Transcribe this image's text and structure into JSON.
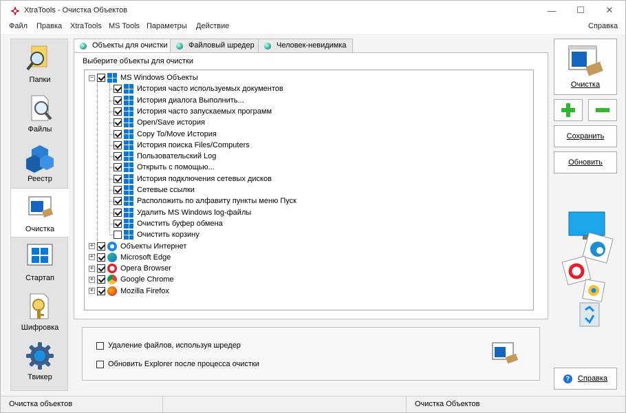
{
  "window": {
    "title": "XtraTools - Очистка Объектов"
  },
  "menu": {
    "items": [
      "Файл",
      "Правка",
      "XtraTools",
      "MS Tools",
      "Параметры",
      "Действие"
    ],
    "help": "Справка"
  },
  "sidebar": {
    "items": [
      {
        "label": "Папки",
        "icon": "folder-search-icon"
      },
      {
        "label": "Файлы",
        "icon": "file-search-icon"
      },
      {
        "label": "Реестр",
        "icon": "registry-icon"
      },
      {
        "label": "Очистка",
        "icon": "cleanup-icon",
        "active": true
      },
      {
        "label": "Стартап",
        "icon": "startup-icon"
      },
      {
        "label": "Шифровка",
        "icon": "encryption-icon"
      },
      {
        "label": "Твикер",
        "icon": "gear-icon"
      }
    ]
  },
  "tabs": [
    {
      "label": "Объекты для очистки",
      "active": true
    },
    {
      "label": "Файловый шредер"
    },
    {
      "label": "Человек-невидимка"
    }
  ],
  "group": {
    "label": "Выберите объекты для очистки"
  },
  "tree": {
    "root": {
      "label": "MS Windows Объекты",
      "checked": true,
      "expanded": true
    },
    "children": [
      {
        "label": "История часто используемых документов",
        "checked": true
      },
      {
        "label": "История диалога Выполнить...",
        "checked": true
      },
      {
        "label": "История часто запускаемых программ",
        "checked": true
      },
      {
        "label": "Open/Save история",
        "checked": true
      },
      {
        "label": "Copy To/Move История",
        "checked": true
      },
      {
        "label": "История поиска Files/Computers",
        "checked": true
      },
      {
        "label": "Пользовательский Log",
        "checked": true
      },
      {
        "label": "Открыть с помощью...",
        "checked": true
      },
      {
        "label": "История подключения сетевых дисков",
        "checked": true
      },
      {
        "label": "Сетевые ссылки",
        "checked": true
      },
      {
        "label": "Расположить по алфавиту пункты меню Пуск",
        "checked": true
      },
      {
        "label": "Удалить MS Windows log-файлы",
        "checked": true
      },
      {
        "label": "Очистить буфер обмена",
        "checked": true
      },
      {
        "label": "Очистить корзину",
        "checked": false
      }
    ],
    "others": [
      {
        "label": "Объекты Интернет",
        "checked": true,
        "icon": "ie-icon"
      },
      {
        "label": "Microsoft Edge",
        "checked": true,
        "icon": "edge-icon"
      },
      {
        "label": "Opera Browser",
        "checked": true,
        "icon": "opera-icon"
      },
      {
        "label": "Google Chrome",
        "checked": true,
        "icon": "chrome-icon"
      },
      {
        "label": "Mozilla Firefox",
        "checked": true,
        "icon": "firefox-icon"
      }
    ]
  },
  "options": [
    {
      "label": "Удаление файлов, используя шредер",
      "checked": false
    },
    {
      "label": "Обновить Explorer после процесса очистки",
      "checked": false
    }
  ],
  "actions": {
    "clean": "Очистка",
    "save": "Сохранить",
    "refresh": "Обновить",
    "help": "Справка"
  },
  "status": {
    "left": "Очистка объектов",
    "right": "Очистка Объектов"
  },
  "colors": {
    "accent": "#0a78d7",
    "tab_dot": "#16a08a",
    "plus": "#2db82d",
    "minus": "#2db82d"
  }
}
